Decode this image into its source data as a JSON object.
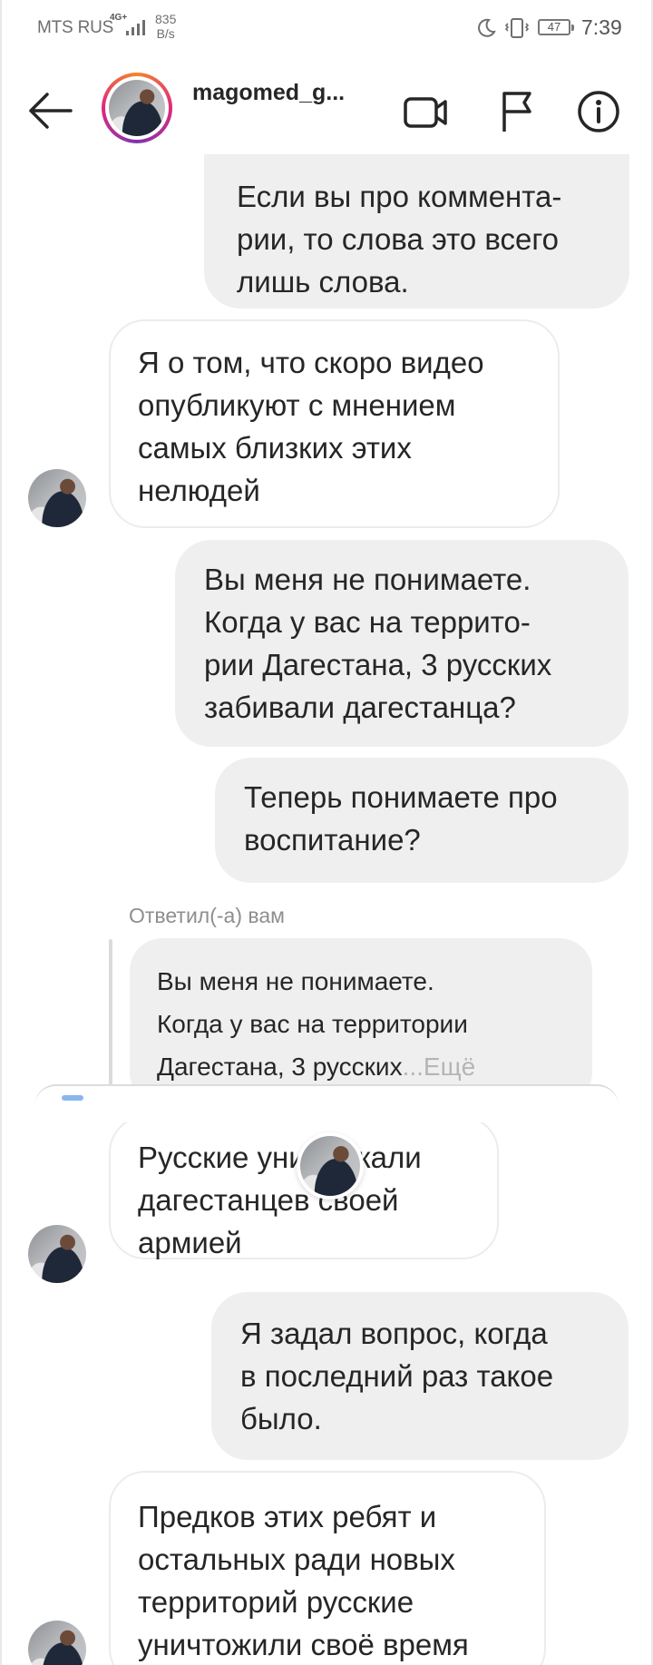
{
  "status_bar": {
    "carrier": "MTS RUS",
    "network": "4G+",
    "speed_value": "835",
    "speed_unit": "B/s",
    "battery": "47",
    "time": "7:39"
  },
  "header": {
    "username": "magomed_g..."
  },
  "icons": {
    "back": "arrow-left-icon",
    "video": "video-camera-icon",
    "flag": "flag-icon",
    "info": "info-icon"
  },
  "messages": [
    {
      "direction": "out",
      "text": "Если вы про коммента-\nрии, то слова это всего\nлишь слова."
    },
    {
      "direction": "in",
      "text": "Я о том, что скоро видео\nопубликуют с мнением\nсамых близких этих\nнелюдей"
    },
    {
      "direction": "out",
      "text": "Вы меня не понимаете.\nКогда у вас на террито-\nрии Дагестана, 3 русских\nзабивали дагестанца?"
    },
    {
      "direction": "out",
      "text": "Теперь понимаете про\nвоспитание?"
    },
    {
      "direction": "in",
      "text": "Русские уничтожали\nдагестанцев своей\nармией"
    },
    {
      "direction": "out",
      "text": "Я задал вопрос, когда\nв последний раз такое\nбыло."
    },
    {
      "direction": "in",
      "text": "Предков этих ребят и\nостальных ради новых\nтерриторий русские\nуничтожили своё время"
    }
  ],
  "reply": {
    "label": "Ответил(-а) вам",
    "quote": "Вы меня не понимаете.\nКогда у вас на территории\nДагестана, 3 русских",
    "more": "...Ещё"
  },
  "colors": {
    "outgoing_bubble": "#efefef",
    "incoming_border": "#ececec",
    "story_ring": [
      "#f58529",
      "#dd2a7b",
      "#8134af"
    ]
  }
}
